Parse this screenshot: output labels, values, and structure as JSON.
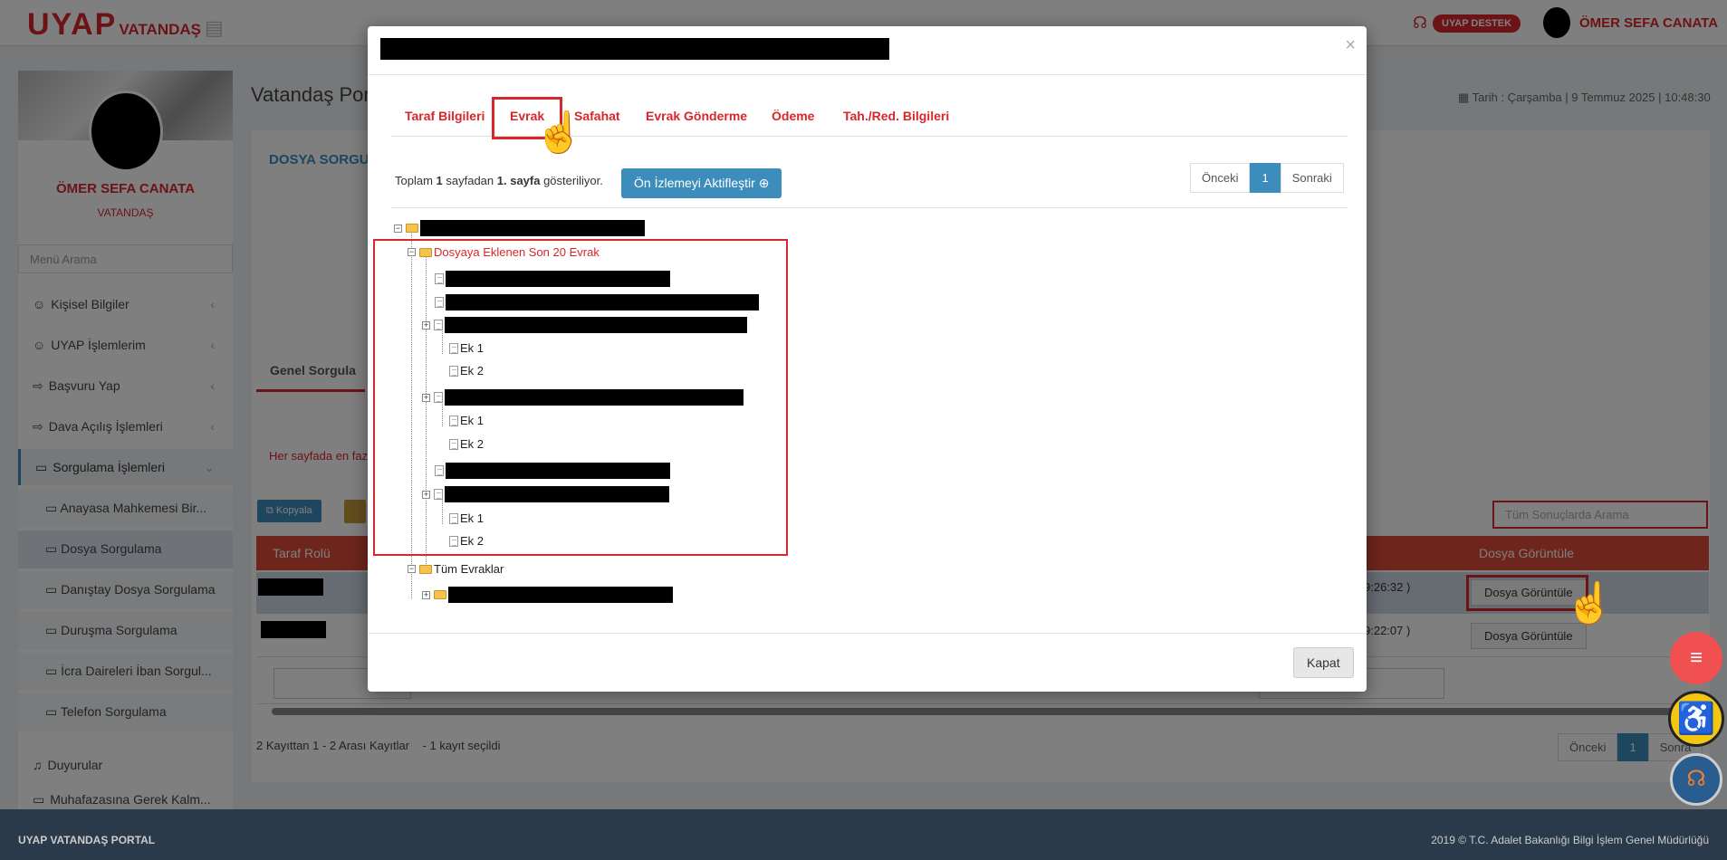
{
  "app": {
    "logo_main": "UYAP",
    "logo_sub": "VATANDAŞ",
    "support_label": "UYAP DESTEK",
    "user_name": "ÖMER SEFA CANATA",
    "date_text": "Tarih : Çarşamba | 9 Temmuz 2025 | 10:48:30"
  },
  "sidebar": {
    "name": "ÖMER SEFA CANATA",
    "role": "VATANDAŞ",
    "search_placeholder": "Menü Arama",
    "items": [
      {
        "label": "Kişisel Bilgiler",
        "icon": "user-icon"
      },
      {
        "label": "UYAP İşlemlerim",
        "icon": "user-gear-icon"
      },
      {
        "label": "Başvuru Yap",
        "icon": "send-icon"
      },
      {
        "label": "Dava Açılış İşlemleri",
        "icon": "send-icon"
      },
      {
        "label": "Sorgulama İşlemleri",
        "icon": "folder-icon"
      }
    ],
    "subitems": [
      "Anayasa Mahkemesi Bir...",
      "Dosya Sorgulama",
      "Danıştay Dosya Sorgulama",
      "Duruşma Sorgulama",
      "İcra Daireleri İban Sorgul...",
      "Telefon Sorgulama"
    ],
    "duyurular": "Duyurular",
    "muhafaza": "Muhafazasına Gerek Kalm..."
  },
  "main": {
    "title": "Vatandaş Por",
    "section": "DOSYA SORGU",
    "tab": "Genel Sorgula",
    "notice": "Her sayfada en faz",
    "copy_button": "Kopyala",
    "search_placeholder": "Tüm Sonuçlarda Arama",
    "col_role": "Taraf Rolü",
    "col_view": "Dosya Görüntüle",
    "rows": [
      {
        "time": "9:26:32 )",
        "button": "Dosya Görüntüle"
      },
      {
        "time": "9:22:07 )",
        "button": "Dosya Görüntüle"
      }
    ],
    "summary": "2 Kayıttan 1 - 2 Arası Kayıtlar",
    "selected": "- 1 kayıt seçildi",
    "prev": "Önceki",
    "page": "1",
    "next": "Sonra"
  },
  "footer": {
    "left": "UYAP VATANDAŞ PORTAL",
    "right": "2019 © T.C. Adalet Bakanlığı Bilgi İşlem Genel Müdürlüğü"
  },
  "modal": {
    "tabs": [
      "Taraf Bilgileri",
      "Evrak",
      "Safahat",
      "Evrak Gönderme",
      "Ödeme",
      "Tah./Red. Bilgileri"
    ],
    "active_tab": "Evrak",
    "pagination_text_a": "Toplam ",
    "pagination_num1": "1",
    "pagination_text_b": " sayfadan ",
    "pagination_num2": "1. sayfa",
    "pagination_text_c": " gösteriliyor.",
    "preview_button": "Ön İzlemeyi Aktifleştir",
    "prev": "Önceki",
    "page": "1",
    "next": "Sonraki",
    "tree": {
      "recent_folder": "Dosyaya Eklenen Son 20 Evrak",
      "attachments": [
        "Ek 1",
        "Ek 2"
      ],
      "all_folder": "Tüm Evraklar"
    },
    "close_button": "Kapat"
  },
  "colors": {
    "brand_red": "#d9262c",
    "accent_blue": "#3c8dbc",
    "table_header": "#dd4b39",
    "footer": "#2b3a4a"
  }
}
